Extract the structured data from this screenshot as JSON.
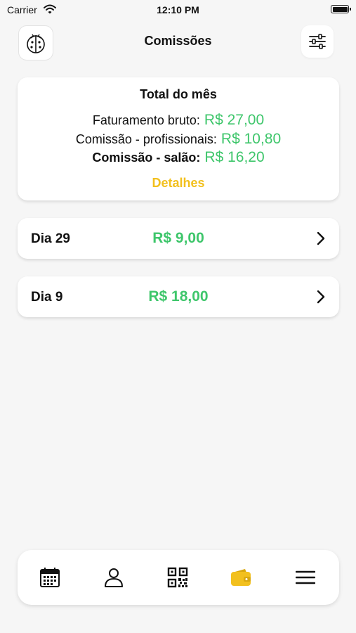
{
  "status": {
    "carrier": "Carrier",
    "time": "12:10 PM"
  },
  "header": {
    "title": "Comissões"
  },
  "summary": {
    "title": "Total do mês",
    "gross_label": "Faturamento bruto:",
    "gross_value": "R$ 27,00",
    "prof_label": "Comissão - profissionais:",
    "prof_value": "R$ 10,80",
    "salon_label": "Comissão - salão:",
    "salon_value": "R$ 16,20",
    "details_label": "Detalhes"
  },
  "days": [
    {
      "label": "Dia 29",
      "value": "R$ 9,00"
    },
    {
      "label": "Dia 9",
      "value": "R$ 18,00"
    }
  ],
  "tabs": [
    {
      "icon": "calendar-icon",
      "active": false
    },
    {
      "icon": "person-icon",
      "active": false
    },
    {
      "icon": "qr-code-icon",
      "active": false
    },
    {
      "icon": "wallet-icon",
      "active": true
    },
    {
      "icon": "menu-icon",
      "active": false
    }
  ],
  "colors": {
    "accent": "#f2c01e",
    "money": "#3ec66b",
    "background": "#f6f6f6"
  }
}
